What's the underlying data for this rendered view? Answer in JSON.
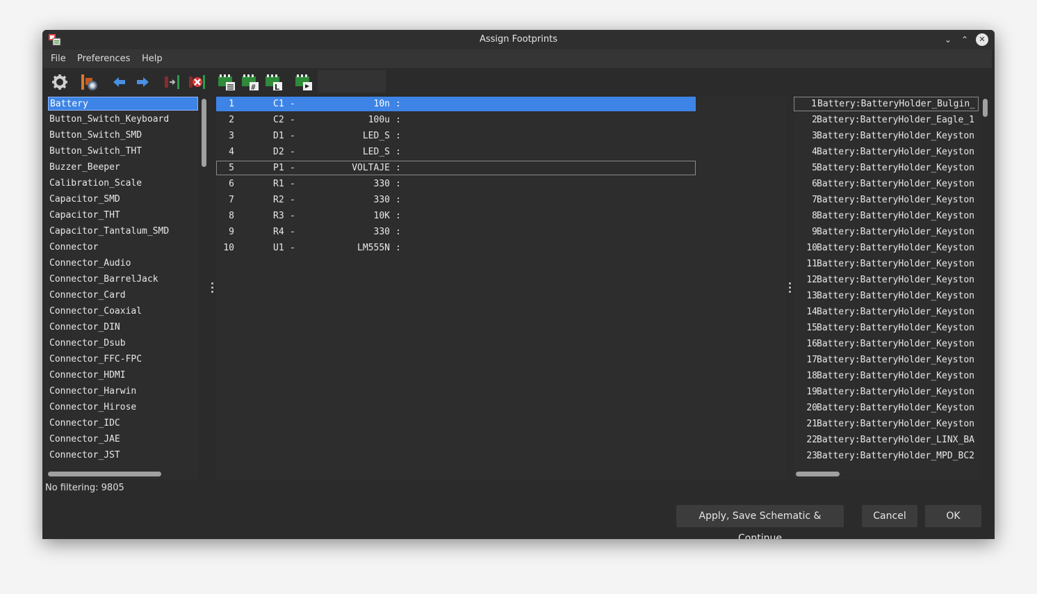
{
  "window": {
    "title": "Assign Footprints"
  },
  "menu": [
    "File",
    "Preferences",
    "Help"
  ],
  "toolbar_icons": [
    "settings-gear-icon",
    "view-footprint-icon",
    "previous-arrow-icon",
    "next-arrow-icon",
    "auto-associate-icon",
    "delete-associations-icon",
    "filter-by-keywords-icon",
    "filter-by-pin-count-icon",
    "filter-by-library-icon",
    "filter-by-text-icon"
  ],
  "libraries": {
    "selected": "Battery",
    "items": [
      "Battery",
      "Button_Switch_Keyboard",
      "Button_Switch_SMD",
      "Button_Switch_THT",
      "Buzzer_Beeper",
      "Calibration_Scale",
      "Capacitor_SMD",
      "Capacitor_THT",
      "Capacitor_Tantalum_SMD",
      "Connector",
      "Connector_Audio",
      "Connector_BarrelJack",
      "Connector_Card",
      "Connector_Coaxial",
      "Connector_DIN",
      "Connector_Dsub",
      "Connector_FFC-FPC",
      "Connector_HDMI",
      "Connector_Harwin",
      "Connector_Hirose",
      "Connector_IDC",
      "Connector_JAE",
      "Connector_JST"
    ]
  },
  "components": [
    {
      "num": "1",
      "ref": "C1",
      "value": "10n"
    },
    {
      "num": "2",
      "ref": "C2",
      "value": "100u"
    },
    {
      "num": "3",
      "ref": "D1",
      "value": "LED_S"
    },
    {
      "num": "4",
      "ref": "D2",
      "value": "LED_S"
    },
    {
      "num": "5",
      "ref": "P1",
      "value": "VOLTAJE"
    },
    {
      "num": "6",
      "ref": "R1",
      "value": "330"
    },
    {
      "num": "7",
      "ref": "R2",
      "value": "330"
    },
    {
      "num": "8",
      "ref": "R3",
      "value": "10K"
    },
    {
      "num": "9",
      "ref": "R4",
      "value": "330"
    },
    {
      "num": "10",
      "ref": "U1",
      "value": "LM555N"
    }
  ],
  "component_separator": "-",
  "component_colon": ":",
  "footprints": [
    {
      "num": "1",
      "name": "Battery:BatteryHolder_Bulgin_"
    },
    {
      "num": "2",
      "name": "Battery:BatteryHolder_Eagle_1"
    },
    {
      "num": "3",
      "name": "Battery:BatteryHolder_Keyston"
    },
    {
      "num": "4",
      "name": "Battery:BatteryHolder_Keyston"
    },
    {
      "num": "5",
      "name": "Battery:BatteryHolder_Keyston"
    },
    {
      "num": "6",
      "name": "Battery:BatteryHolder_Keyston"
    },
    {
      "num": "7",
      "name": "Battery:BatteryHolder_Keyston"
    },
    {
      "num": "8",
      "name": "Battery:BatteryHolder_Keyston"
    },
    {
      "num": "9",
      "name": "Battery:BatteryHolder_Keyston"
    },
    {
      "num": "10",
      "name": "Battery:BatteryHolder_Keyston"
    },
    {
      "num": "11",
      "name": "Battery:BatteryHolder_Keyston"
    },
    {
      "num": "12",
      "name": "Battery:BatteryHolder_Keyston"
    },
    {
      "num": "13",
      "name": "Battery:BatteryHolder_Keyston"
    },
    {
      "num": "14",
      "name": "Battery:BatteryHolder_Keyston"
    },
    {
      "num": "15",
      "name": "Battery:BatteryHolder_Keyston"
    },
    {
      "num": "16",
      "name": "Battery:BatteryHolder_Keyston"
    },
    {
      "num": "17",
      "name": "Battery:BatteryHolder_Keyston"
    },
    {
      "num": "18",
      "name": "Battery:BatteryHolder_Keyston"
    },
    {
      "num": "19",
      "name": "Battery:BatteryHolder_Keyston"
    },
    {
      "num": "20",
      "name": "Battery:BatteryHolder_Keyston"
    },
    {
      "num": "21",
      "name": "Battery:BatteryHolder_Keyston"
    },
    {
      "num": "22",
      "name": "Battery:BatteryHolder_LINX_BA"
    },
    {
      "num": "23",
      "name": "Battery:BatteryHolder_MPD_BC2"
    }
  ],
  "status": "No filtering: 9805",
  "buttons": {
    "apply": "Apply, Save Schematic & Continue",
    "cancel": "Cancel",
    "ok": "OK"
  },
  "colors": {
    "selection": "#3d84e6",
    "background": "#2b2b2b",
    "panel": "#2d2d2d"
  }
}
